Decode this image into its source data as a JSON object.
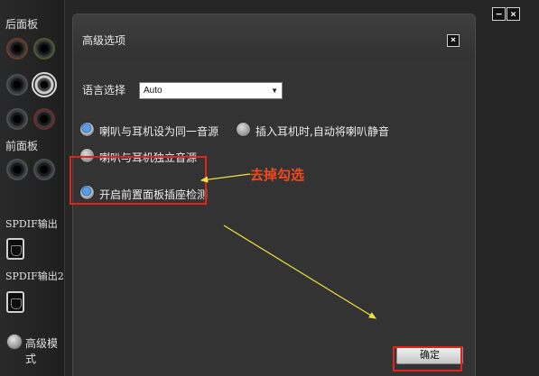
{
  "left_panel": {
    "rear_panel_label": "后面板",
    "front_panel_label": "前面板",
    "spdif_out_label": "SPDIF输出",
    "spdif_out2_label": "SPDIF输出2",
    "advanced_mode_label": "高级模式"
  },
  "window_buttons": {
    "minimize": "−",
    "close": "×"
  },
  "dialog": {
    "title": "高级选项",
    "close_glyph": "×",
    "language_label": "语言选择",
    "language_value": "Auto",
    "options": [
      {
        "label": "喇叭与耳机设为同一音源",
        "selected": true
      },
      {
        "label": "插入耳机时,自动将喇叭静音",
        "selected": false
      },
      {
        "label": "喇叭与耳机独立音源",
        "selected": false
      },
      {
        "label": "开启前置面板插座检测",
        "selected": true
      }
    ],
    "confirm_label": "确定"
  },
  "annotation": {
    "text": "去掉勾选",
    "color": "#e0241a",
    "arrow_color": "#f2e23a"
  },
  "colors": {
    "radio_selected": "#2f6fb8",
    "dialog_bg": "#333333"
  }
}
